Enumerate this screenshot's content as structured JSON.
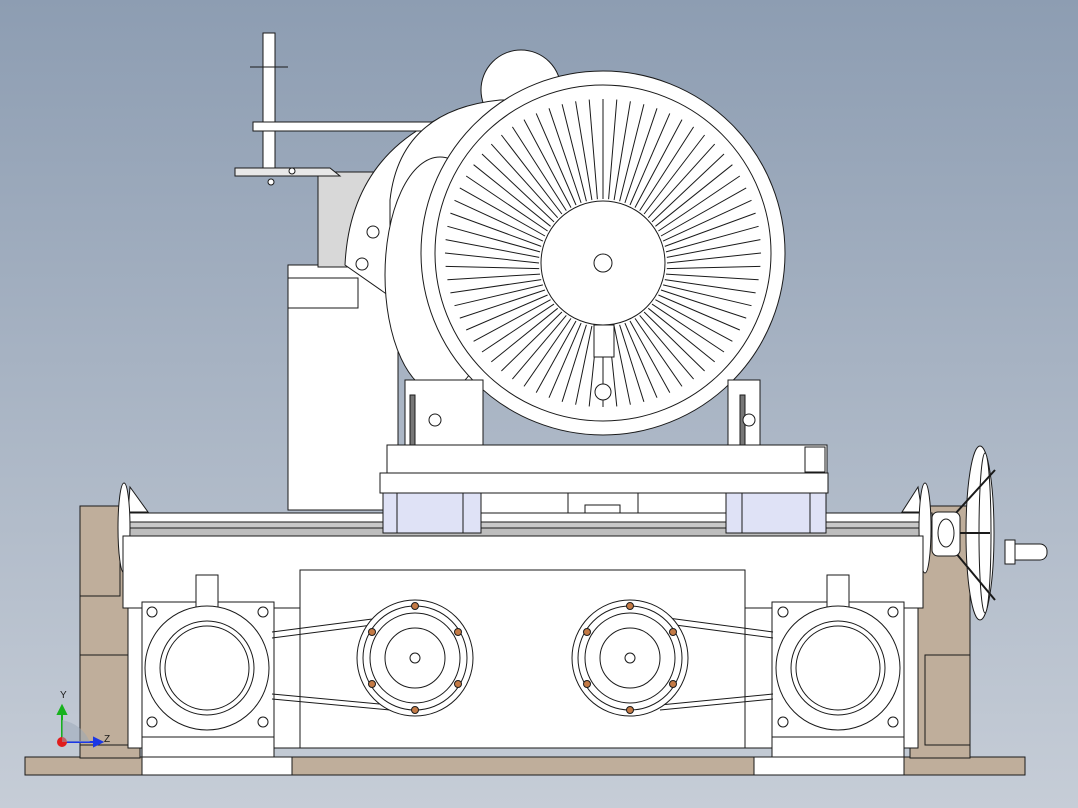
{
  "viewport": {
    "background_top": "#8d9db2",
    "background_bottom": "#c6cdd7",
    "model_color": "#ffffff",
    "base_color": "#bfae9b",
    "bearing_block_color": "#dfe2f6",
    "edge_color": "#1a1a1a"
  },
  "triad": {
    "y_label": "Y",
    "z_label": "Z",
    "x_color": "#e01d1d",
    "y_color": "#17b21d",
    "z_color": "#1b37e6"
  }
}
